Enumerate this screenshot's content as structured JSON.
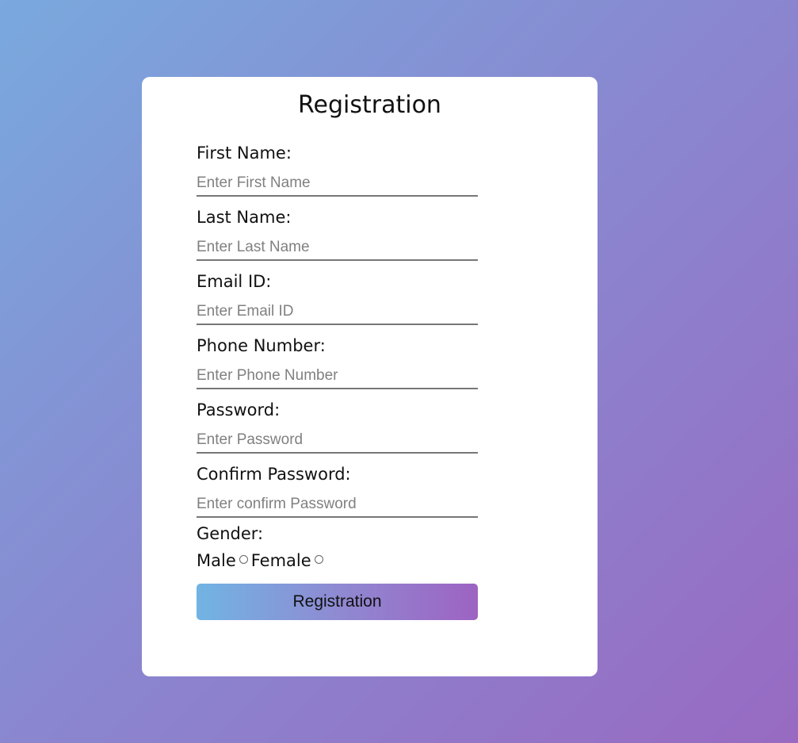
{
  "form": {
    "title": "Registration",
    "fields": [
      {
        "label": "First Name:",
        "placeholder": "Enter First Name",
        "value": ""
      },
      {
        "label": "Last Name:",
        "placeholder": "Enter Last Name",
        "value": ""
      },
      {
        "label": "Email ID:",
        "placeholder": "Enter Email ID",
        "value": ""
      },
      {
        "label": "Phone Number:",
        "placeholder": "Enter Phone Number",
        "value": ""
      },
      {
        "label": "Password:",
        "placeholder": "Enter Password",
        "value": ""
      },
      {
        "label": "Confirm Password:",
        "placeholder": "Enter confirm Password",
        "value": ""
      }
    ],
    "gender": {
      "label": "Gender:",
      "options": [
        {
          "label": "Male",
          "selected": false
        },
        {
          "label": "Female",
          "selected": false
        }
      ]
    },
    "submit_label": "Registration"
  },
  "colors": {
    "background_start": "#79a9de",
    "background_end": "#986ac2",
    "button_start": "#71b4e4",
    "button_end": "#9d63c2",
    "card": "#ffffff"
  }
}
